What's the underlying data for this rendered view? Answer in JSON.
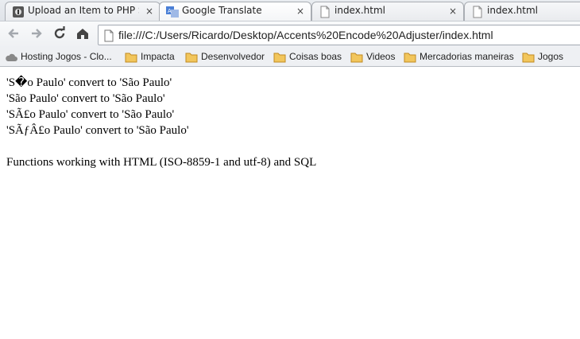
{
  "tabs": [
    {
      "title": "Upload an Item to PHP Sc",
      "close": "×",
      "favicon": "php-classes-icon"
    },
    {
      "title": "Google Translate",
      "close": "×",
      "favicon": "google-translate-icon"
    },
    {
      "title": "index.html",
      "close": "×",
      "favicon": "page-icon"
    },
    {
      "title": "index.html",
      "close": "×",
      "favicon": "page-icon"
    }
  ],
  "toolbar": {
    "back_icon": "back-arrow-icon",
    "forward_icon": "forward-arrow-icon",
    "reload_icon": "reload-icon",
    "home_icon": "home-icon",
    "url": "file:///C:/Users/Ricardo/Desktop/Accents%20Encode%20Adjuster/index.html"
  },
  "bookmarks": [
    {
      "label": "Hosting Jogos - Clo...",
      "icon": "cloud-icon"
    },
    {
      "label": "Impacta",
      "icon": "folder-icon"
    },
    {
      "label": "Desenvolvedor",
      "icon": "folder-icon"
    },
    {
      "label": "Coisas boas",
      "icon": "folder-icon"
    },
    {
      "label": "Videos",
      "icon": "folder-icon"
    },
    {
      "label": "Mercadorias maneiras",
      "icon": "folder-icon"
    },
    {
      "label": "Jogos",
      "icon": "folder-icon"
    }
  ],
  "content": {
    "lines": [
      "'S�o Paulo' convert to 'São Paulo'",
      "'São Paulo' convert to 'São Paulo'",
      "'SÃ£o Paulo' convert to 'São Paulo'",
      "'SÃƒÂ£o Paulo' convert to 'São Paulo'"
    ],
    "footer": "Functions working with HTML (ISO-8859-1 and utf-8) and SQL"
  },
  "colors": {
    "folder": "#e8b24a",
    "chrome_bg": "#eef0f3"
  }
}
